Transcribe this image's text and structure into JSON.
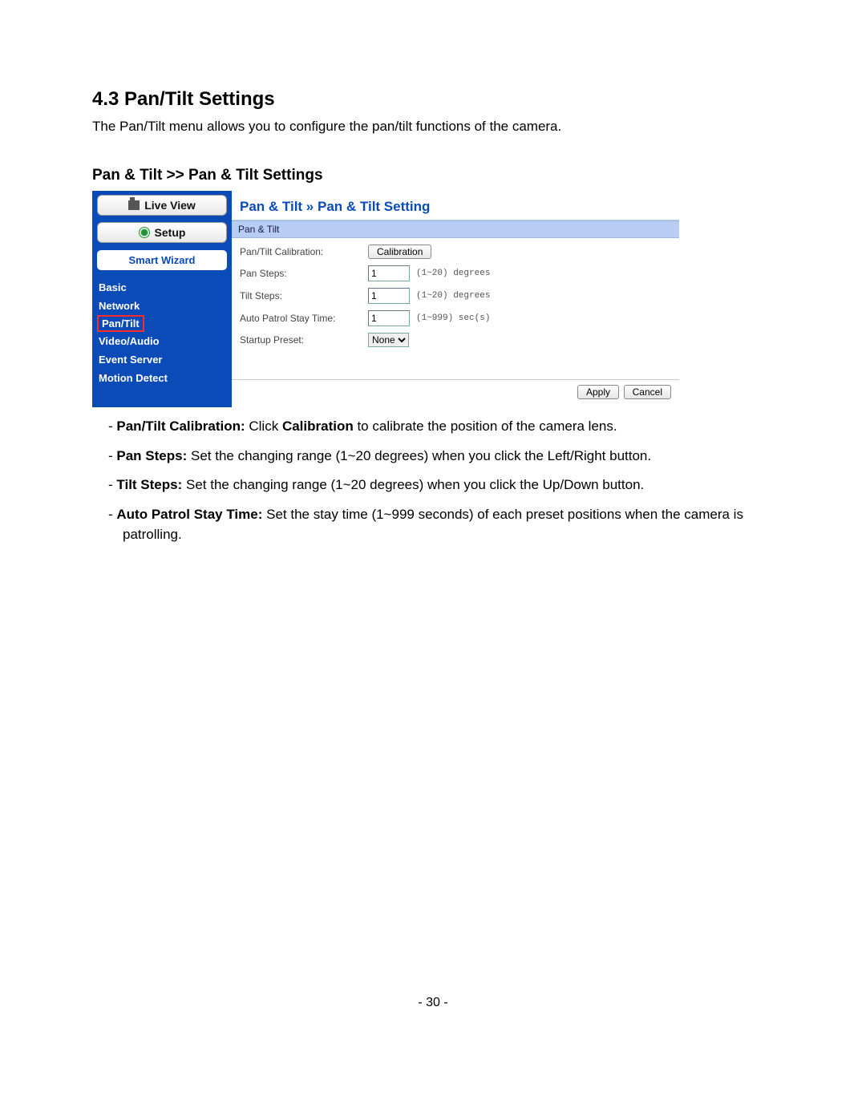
{
  "section_number_title": "4.3  Pan/Tilt Settings",
  "intro": "The Pan/Tilt menu allows you to configure the pan/tilt functions of the camera.",
  "subsection": "Pan & Tilt >> Pan & Tilt Settings",
  "sidebar": {
    "live_view": "Live View",
    "setup": "Setup",
    "wizard": "Smart Wizard",
    "items": [
      "Basic",
      "Network",
      "Pan/Tilt",
      "Video/Audio",
      "Event Server",
      "Motion Detect"
    ],
    "active_index": 2
  },
  "panel": {
    "breadcrumb": "Pan & Tilt » Pan & Tilt Setting",
    "subbar": "Pan & Tilt",
    "rows": {
      "calibration_label": "Pan/Tilt Calibration:",
      "calibration_button": "Calibration",
      "pan_steps_label": "Pan Steps:",
      "pan_steps_value": "1",
      "pan_steps_hint": "(1~20) degrees",
      "tilt_steps_label": "Tilt Steps:",
      "tilt_steps_value": "1",
      "tilt_steps_hint": "(1~20) degrees",
      "auto_patrol_label": "Auto Patrol Stay Time:",
      "auto_patrol_value": "1",
      "auto_patrol_hint": "(1~999) sec(s)",
      "startup_preset_label": "Startup Preset:",
      "startup_preset_value": "None"
    },
    "apply": "Apply",
    "cancel": "Cancel"
  },
  "bullets": {
    "b1_bold": "Pan/Tilt Calibration: ",
    "b1_mid": "Click ",
    "b1_bold2": "Calibration",
    "b1_rest": " to calibrate the position of the camera lens.",
    "b2_bold": "Pan Steps: ",
    "b2_rest": "Set the changing range (1~20 degrees) when you click the Left/Right button.",
    "b3_bold": "Tilt Steps: ",
    "b3_rest": "Set the changing range (1~20 degrees) when you click the Up/Down button.",
    "b4_bold": "Auto Patrol Stay Time: ",
    "b4_rest": "Set the stay time (1~999 seconds) of each preset positions when the camera is patrolling."
  },
  "page_number": "- 30 -"
}
